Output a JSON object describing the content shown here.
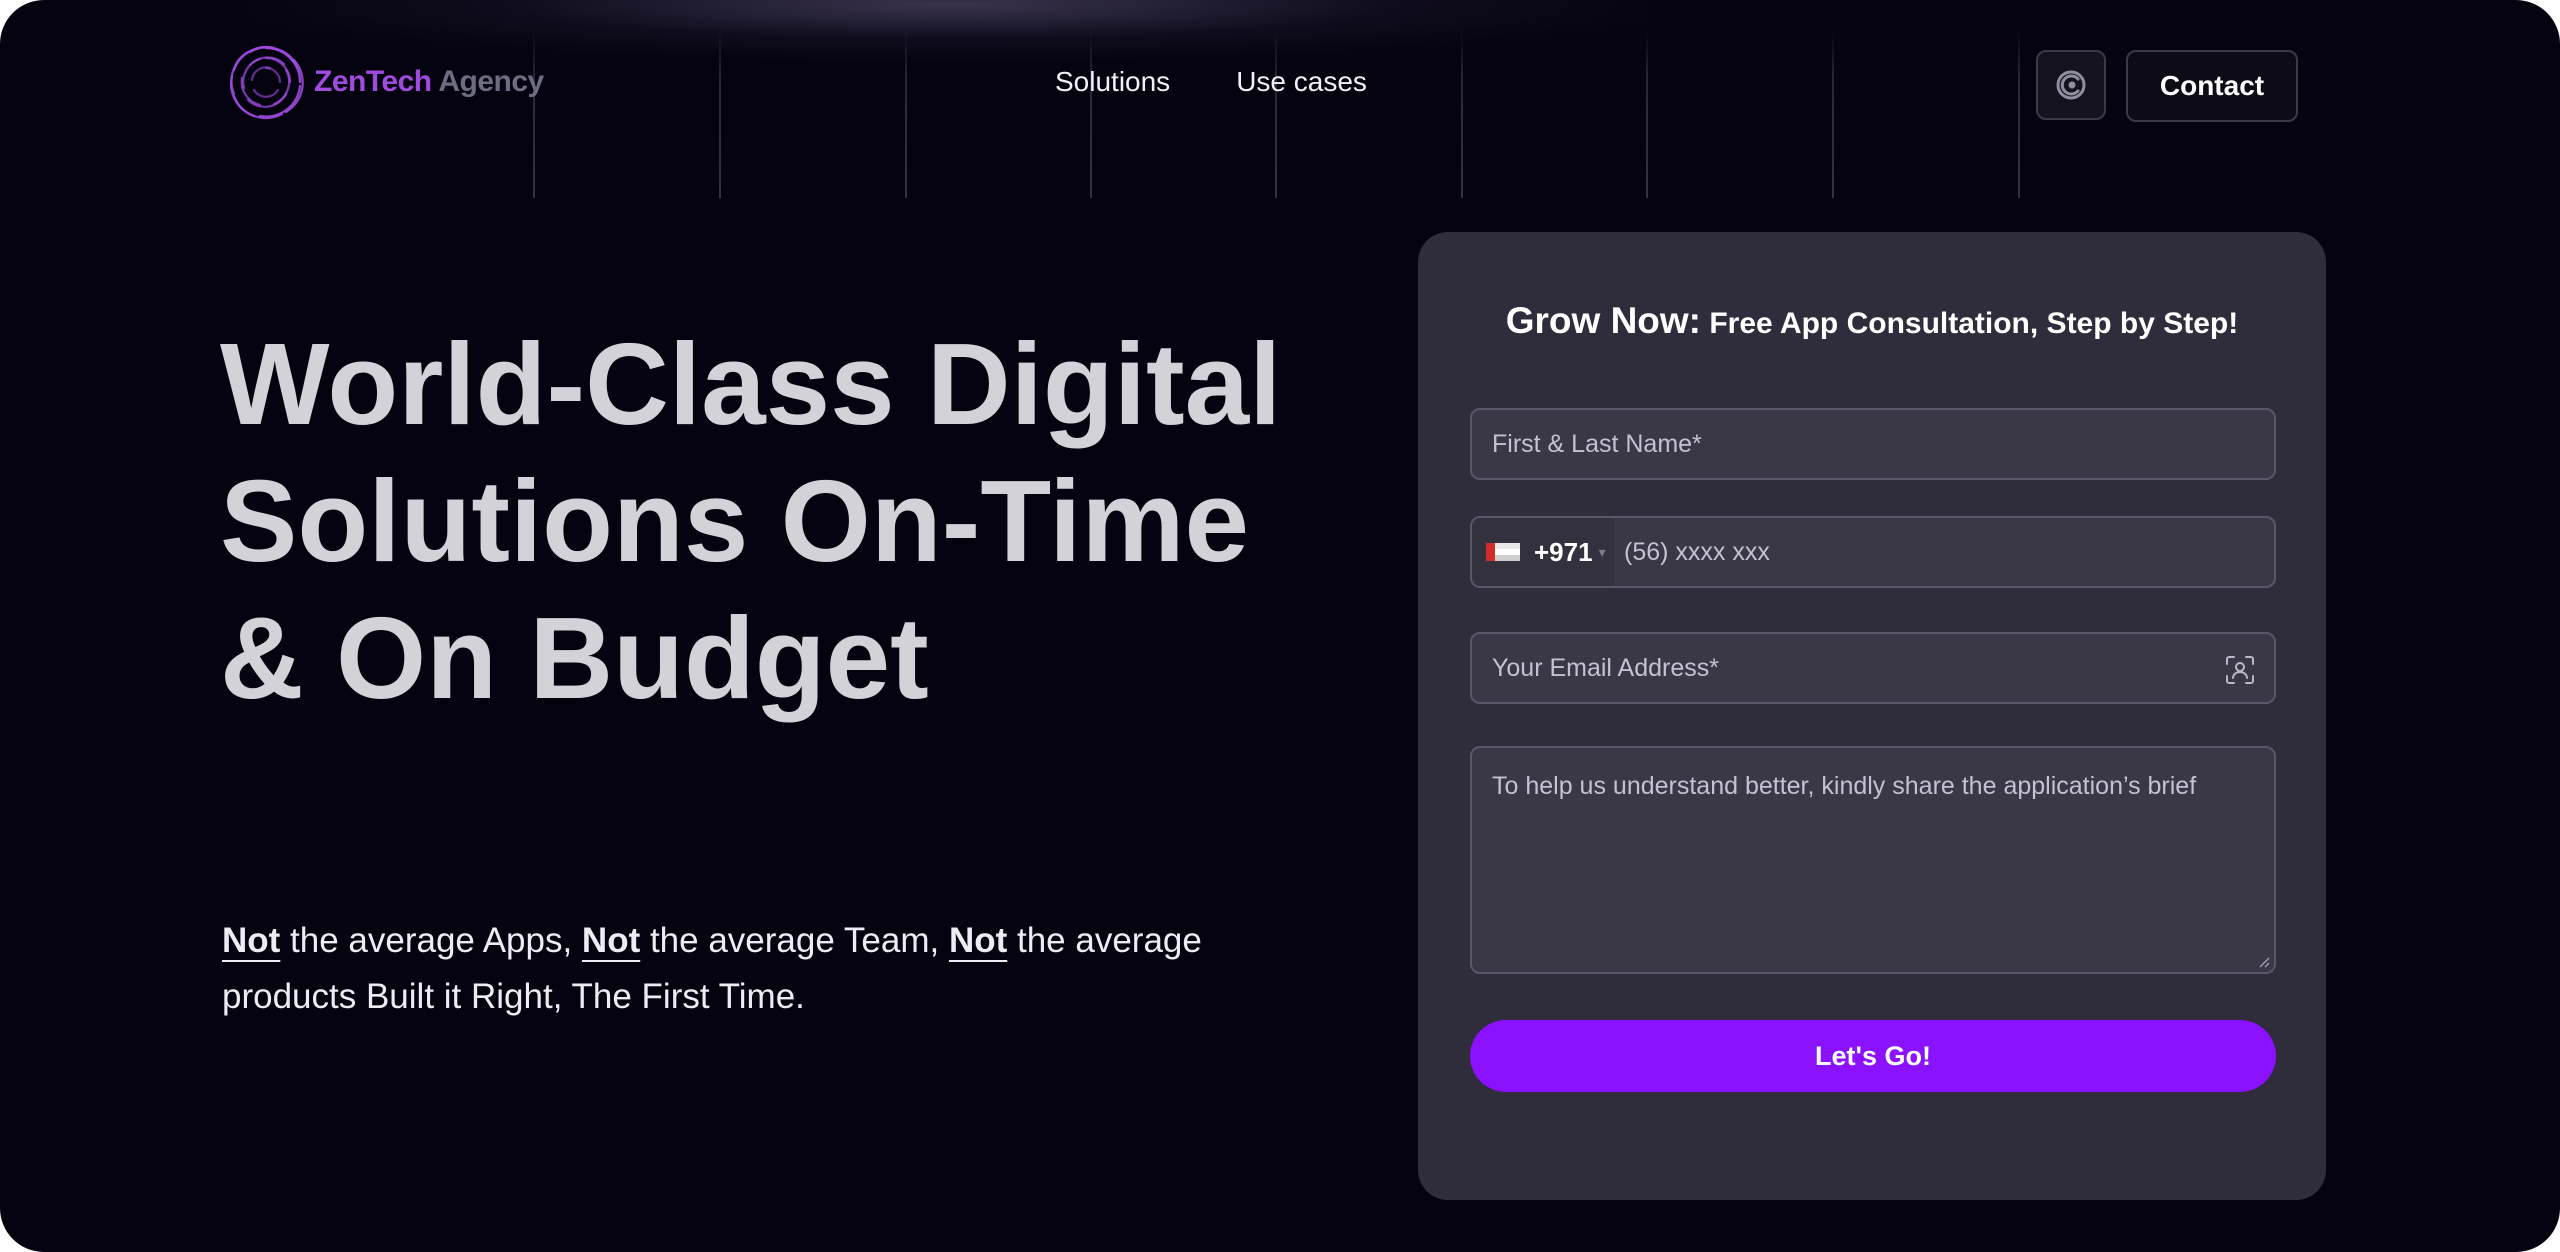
{
  "brand": {
    "name_part1": "ZenTech",
    "name_part2": "Agency",
    "accent_color": "#a04be0"
  },
  "nav": {
    "items": [
      {
        "label": "Solutions"
      },
      {
        "label": "Use cases"
      }
    ],
    "theme_icon": "theme-toggle-icon",
    "contact_label": "Contact"
  },
  "hero": {
    "title": "World-Class Digital Solutions On-Time & On Budget",
    "subtitle": {
      "not_word": "Not",
      "part1": " the average Apps, ",
      "part2": " the average Team, ",
      "part3": " the average products Built it Right, The First Time."
    }
  },
  "form": {
    "title_bold": "Grow Now:",
    "title_rest": " Free App Consultation, Step by Step!",
    "name_placeholder": "First & Last Name*",
    "phone_code": "+971",
    "phone_placeholder": "(56) xxxx xxx",
    "email_placeholder": "Your Email Address*",
    "brief_placeholder": "To help us understand better, kindly share the application’s brief",
    "submit_label": "Let's Go!",
    "submit_color": "#8b12ff"
  }
}
